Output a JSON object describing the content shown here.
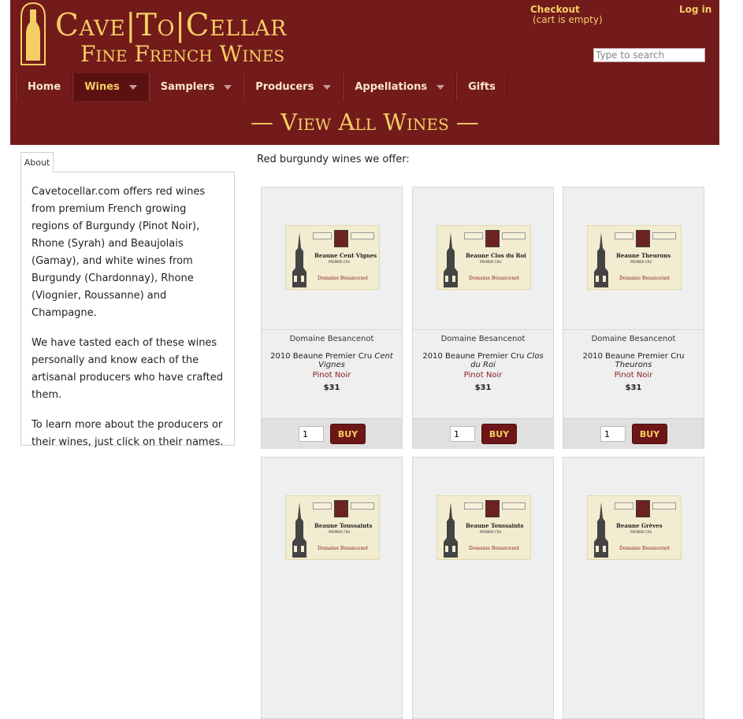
{
  "header": {
    "logo_title": "Cave|To|Cellar",
    "logo_subtitle": "Fine French Wines",
    "checkout": "Checkout",
    "cart_status": "(cart is empty)",
    "login": "Log in",
    "search_placeholder": "Type to search",
    "page_heading": "— View All Wines —"
  },
  "nav": [
    {
      "label": "Home",
      "dropdown": false,
      "active": false
    },
    {
      "label": "Wines",
      "dropdown": true,
      "active": true
    },
    {
      "label": "Samplers",
      "dropdown": true,
      "active": false
    },
    {
      "label": "Producers",
      "dropdown": true,
      "active": false
    },
    {
      "label": "Appellations",
      "dropdown": true,
      "active": false
    },
    {
      "label": "Gifts",
      "dropdown": false,
      "active": false
    }
  ],
  "about": {
    "tab": "About",
    "paragraphs": [
      "Cavetocellar.com offers red wines from premium French growing regions of Burgundy (Pinot Noir), Rhone (Syrah) and Beaujolais (Gamay), and white wines from Burgundy (Chardonnay), Rhone (Viognier, Roussanne) and Champagne.",
      "We have tasted each of these wines personally and know each of the artisanal producers who have crafted them.",
      "To learn more about the producers or their wines, just click on their names."
    ]
  },
  "intro": "Red burgundy wines we offer:",
  "products": [
    {
      "label_name": "Beaune Cent Vignes",
      "producer": "Domaine Besancenot",
      "wine_prefix": "2010 Beaune Premier Cru ",
      "wine_italic": "Cent Vignes",
      "varietal": "Pinot Noir",
      "price": "$31",
      "qty": "1",
      "buy": "BUY"
    },
    {
      "label_name": "Beaune Clos du Roi",
      "producer": "Domaine Besancenot",
      "wine_prefix": "2010 Beaune Premier Cru ",
      "wine_italic": "Clos du Roi",
      "varietal": "Pinot Noir",
      "price": "$31",
      "qty": "1",
      "buy": "BUY"
    },
    {
      "label_name": "Beaune Theurons",
      "producer": "Domaine Besancenot",
      "wine_prefix": "2010 Beaune Premier Cru ",
      "wine_italic": "Theurons",
      "varietal": "Pinot Noir",
      "price": "$31",
      "qty": "1",
      "buy": "BUY"
    },
    {
      "label_name": "Beaune Toussaints",
      "partial": true
    },
    {
      "label_name": "Beaune Toussaints",
      "partial": true
    },
    {
      "label_name": "Beaune Grèves",
      "partial": true
    }
  ],
  "label_common": {
    "premier_cru": "PREMIER CRU",
    "domaine": "Domaine Besancenot"
  }
}
